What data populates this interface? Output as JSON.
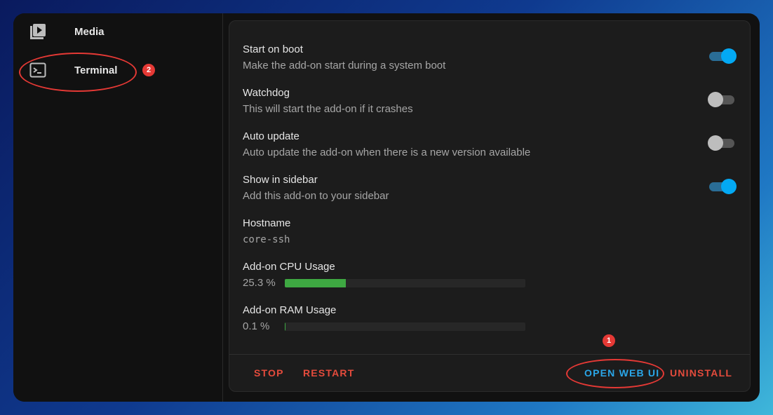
{
  "sidebar": {
    "items": [
      {
        "label": "Media",
        "icon": "media-icon"
      },
      {
        "label": "Terminal",
        "icon": "terminal-icon"
      }
    ]
  },
  "annotations": {
    "badge_1": "1",
    "badge_2": "2",
    "color": "#e53935"
  },
  "options": [
    {
      "title": "Start on boot",
      "description": "Make the add-on start during a system boot",
      "enabled": true
    },
    {
      "title": "Watchdog",
      "description": "This will start the add-on if it crashes",
      "enabled": false
    },
    {
      "title": "Auto update",
      "description": "Auto update the add-on when there is a new version available",
      "enabled": false
    },
    {
      "title": "Show in sidebar",
      "description": "Add this add-on to your sidebar",
      "enabled": true
    }
  ],
  "hostname": {
    "label": "Hostname",
    "value": "core-ssh"
  },
  "cpu": {
    "label": "Add-on CPU Usage",
    "value": "25.3 %",
    "percent": 25.3
  },
  "ram": {
    "label": "Add-on RAM Usage",
    "value": "0.1 %",
    "percent": 0.1
  },
  "actions": {
    "stop": "STOP",
    "restart": "RESTART",
    "open_web_ui": "OPEN WEB UI",
    "uninstall": "UNINSTALL"
  },
  "colors": {
    "accent": "#03a9f4",
    "danger": "#e44b3c",
    "meter": "#3ea842"
  }
}
